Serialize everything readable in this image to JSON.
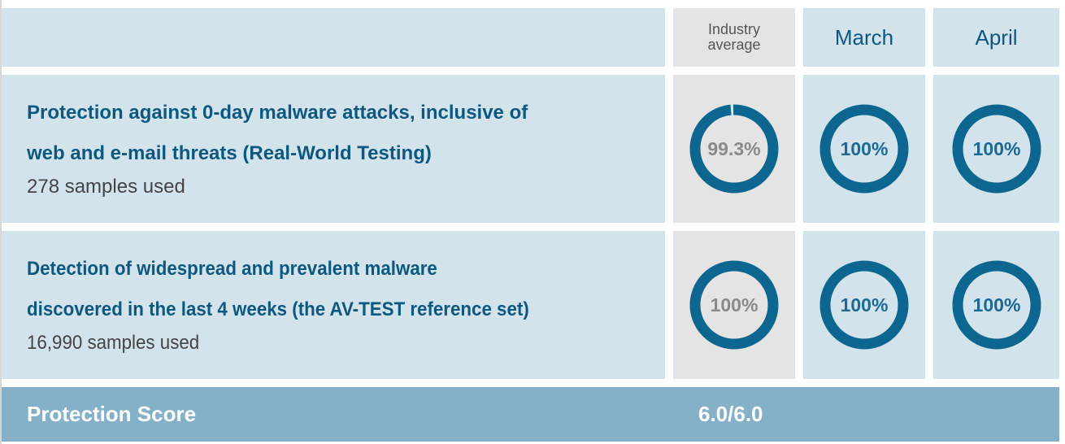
{
  "header": {
    "industry_average": "Industry average",
    "industry_average_line1": "Industry",
    "industry_average_line2": "average",
    "months": [
      "March",
      "April"
    ]
  },
  "rows": [
    {
      "title_line1": "Protection against 0-day malware attacks, inclusive of",
      "title_line2": "web and e-mail threats (Real-World Testing)",
      "samples": "278 samples used",
      "industry_average": {
        "value": 99.3,
        "label": "99.3%"
      },
      "march": {
        "value": 100,
        "label": "100%"
      },
      "april": {
        "value": 100,
        "label": "100%"
      }
    },
    {
      "title_line1": "Detection of widespread and prevalent malware",
      "title_line2": "discovered in the last 4 weeks (the AV-TEST reference set)",
      "samples": "16,990 samples used",
      "industry_average": {
        "value": 100,
        "label": "100%"
      },
      "march": {
        "value": 100,
        "label": "100%"
      },
      "april": {
        "value": 100,
        "label": "100%"
      }
    }
  ],
  "score": {
    "label": "Protection Score",
    "value": "6.0/6.0"
  },
  "colors": {
    "ring": "#0d6690",
    "ring_text_product": "#1a6a93",
    "ring_text_industry": "#8a8a8a",
    "heading_text": "#0d587f",
    "cell_blue": "#d3e3ec",
    "cell_gray": "#e4e4e4",
    "score_bar": "#84b0c8"
  }
}
